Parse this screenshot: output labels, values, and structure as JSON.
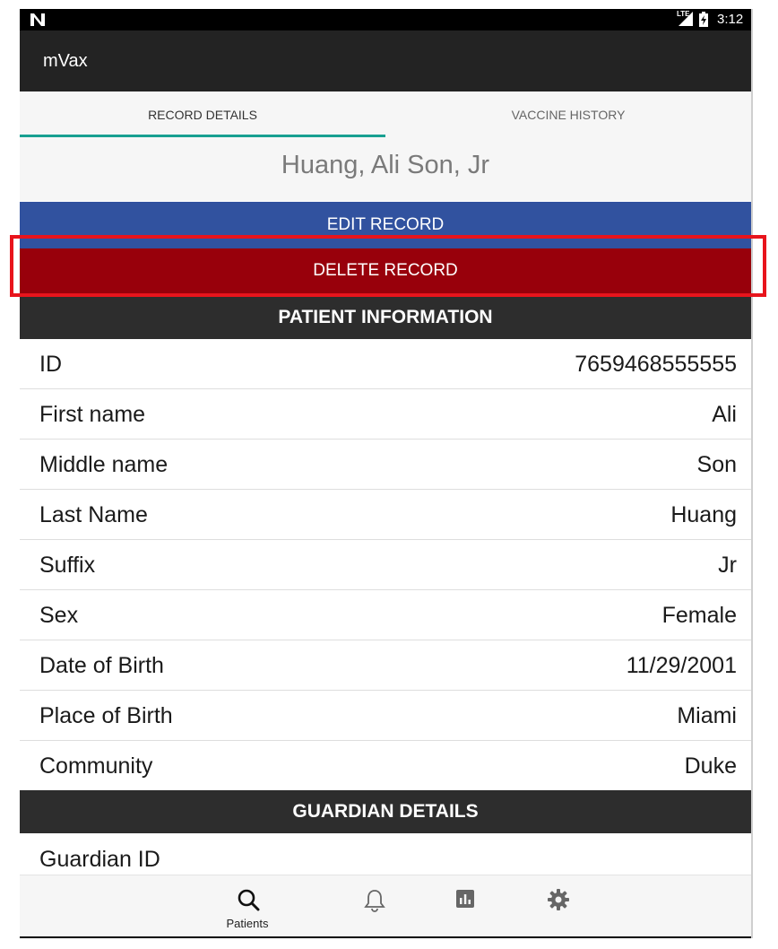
{
  "status_bar": {
    "network_label": "LTE",
    "time": "3:12"
  },
  "app": {
    "title": "mVax"
  },
  "tabs": [
    {
      "label": "RECORD DETAILS",
      "active": true
    },
    {
      "label": "VACCINE HISTORY",
      "active": false
    }
  ],
  "patient": {
    "display_name": "Huang, Ali Son, Jr"
  },
  "actions": {
    "edit_label": "EDIT RECORD",
    "delete_label": "DELETE RECORD"
  },
  "sections": {
    "patient_info": "PATIENT INFORMATION",
    "guardian": "GUARDIAN DETAILS"
  },
  "fields": [
    {
      "label": "ID",
      "value": "7659468555555"
    },
    {
      "label": "First name",
      "value": "Ali"
    },
    {
      "label": "Middle name",
      "value": "Son"
    },
    {
      "label": "Last Name",
      "value": "Huang"
    },
    {
      "label": "Suffix",
      "value": "Jr"
    },
    {
      "label": "Sex",
      "value": "Female"
    },
    {
      "label": "Date of Birth",
      "value": "11/29/2001"
    },
    {
      "label": "Place of Birth",
      "value": "Miami"
    },
    {
      "label": "Community",
      "value": "Duke"
    }
  ],
  "guardian": {
    "id_label": "Guardian ID"
  },
  "bottom_nav": [
    {
      "icon": "search-icon",
      "label": "Patients"
    },
    {
      "icon": "bell-icon",
      "label": ""
    },
    {
      "icon": "chart-icon",
      "label": ""
    },
    {
      "icon": "gear-icon",
      "label": ""
    }
  ],
  "colors": {
    "edit": "#31529f",
    "delete": "#98000b",
    "tab_indicator": "#17a091",
    "highlight": "#e8141c"
  }
}
